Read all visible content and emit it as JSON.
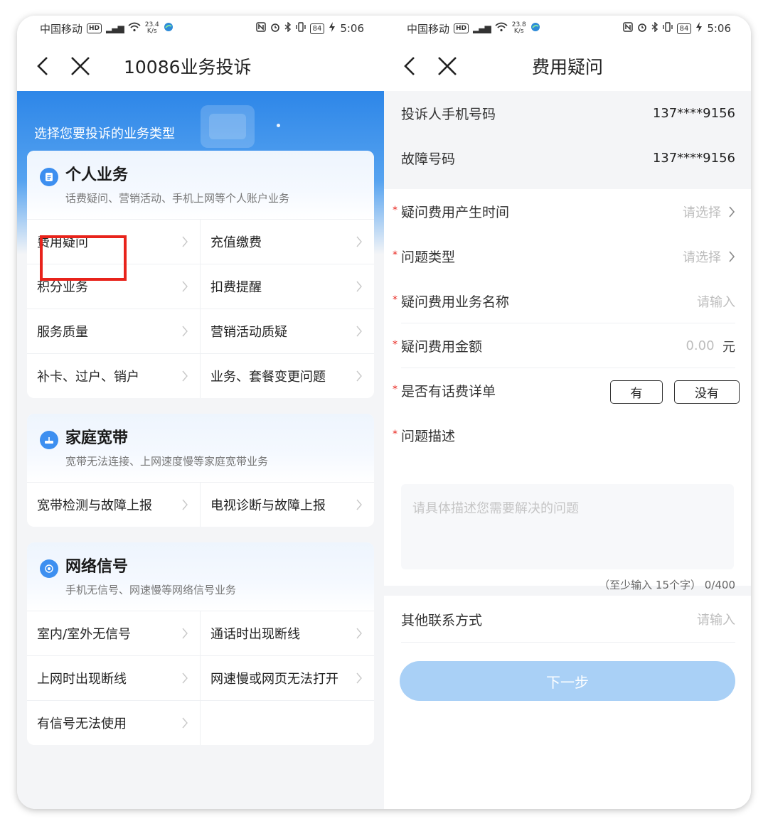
{
  "left": {
    "status": {
      "carrier": "中国移动",
      "hd": "HD",
      "net": "4G",
      "speed_top": "23.4",
      "speed_unit": "K/s",
      "battery": "84",
      "time": "5:06"
    },
    "nav": {
      "title": "10086业务投诉"
    },
    "hero": {
      "text": "选择您要投诉的业务类型"
    },
    "sections": [
      {
        "title": "个人业务",
        "subtitle": "话费疑问、营销活动、手机上网等个人账户业务",
        "items": [
          "费用疑问",
          "充值缴费",
          "积分业务",
          "扣费提醒",
          "服务质量",
          "营销活动质疑",
          "补卡、过户、销户",
          "业务、套餐变更问题"
        ]
      },
      {
        "title": "家庭宽带",
        "subtitle": "宽带无法连接、上网速度慢等家庭宽带业务",
        "items": [
          "宽带检测与故障上报",
          "电视诊断与故障上报"
        ]
      },
      {
        "title": "网络信号",
        "subtitle": "手机无信号、网速慢等网络信号业务",
        "items": [
          "室内/室外无信号",
          "通话时出现断线",
          "上网时出现断线",
          "网速慢或网页无法打开",
          "有信号无法使用"
        ]
      }
    ]
  },
  "right": {
    "status": {
      "carrier": "中国移动",
      "hd": "HD",
      "net": "4G",
      "speed_top": "23.8",
      "speed_unit": "K/s",
      "battery": "84",
      "time": "5:06"
    },
    "nav": {
      "title": "费用疑问"
    },
    "info": [
      {
        "label": "投诉人手机号码",
        "value": "137****9156"
      },
      {
        "label": "故障号码",
        "value": "137****9156"
      }
    ],
    "form": {
      "time": {
        "label": "疑问费用产生时间",
        "placeholder": "请选择"
      },
      "type": {
        "label": "问题类型",
        "placeholder": "请选择"
      },
      "name": {
        "label": "疑问费用业务名称",
        "placeholder": "请输入"
      },
      "amount": {
        "label": "疑问费用金额",
        "placeholder": "0.00",
        "unit": "元"
      },
      "detail": {
        "label": "是否有话费详单",
        "yes": "有",
        "no": "没有"
      },
      "desc": {
        "label": "问题描述",
        "placeholder": "请具体描述您需要解决的问题",
        "counter": "（至少输入 15个字） 0/400"
      },
      "required_mark": "*"
    },
    "other": {
      "label": "其他联系方式",
      "placeholder": "请输入"
    },
    "next_label": "下一步"
  },
  "colors": {
    "accent": "#2d86e8",
    "highlight": "#e8231b",
    "button": "#a9d0f6"
  }
}
